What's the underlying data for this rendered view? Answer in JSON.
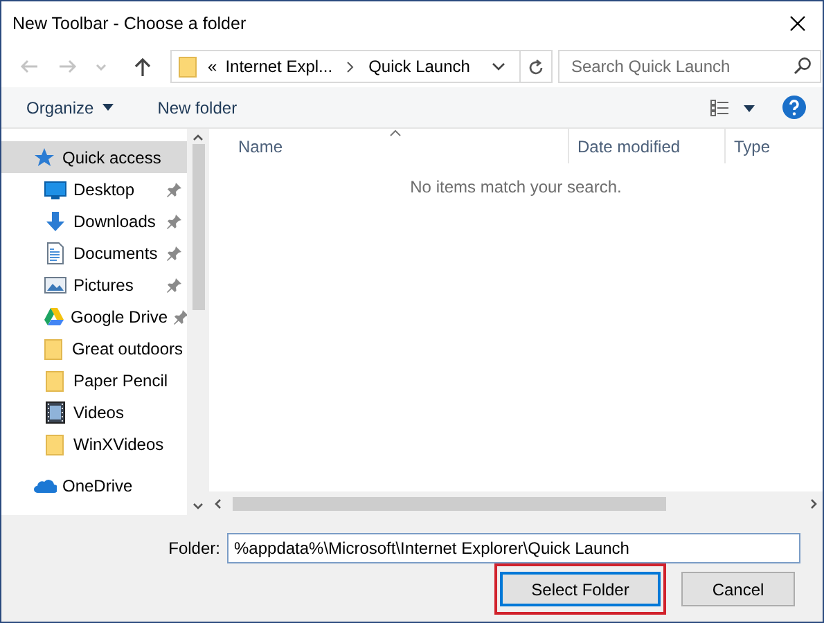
{
  "window": {
    "title": "New Toolbar - Choose a folder"
  },
  "navigation": [
    {
      "kind": "back",
      "disabled": true
    },
    {
      "kind": "forward",
      "disabled": true
    },
    {
      "kind": "recent",
      "disabled": true
    },
    {
      "kind": "up",
      "disabled": false
    }
  ],
  "address_bar": {
    "overflow": "«",
    "breadcrumbs": [
      "Internet Expl...",
      "Quick Launch"
    ]
  },
  "search": {
    "placeholder": "Search Quick Launch"
  },
  "toolbar": [
    {
      "label": "Organize",
      "kind": "menu"
    },
    {
      "label": "New folder",
      "kind": "button"
    }
  ],
  "sidebar": {
    "items": [
      {
        "label": "Quick access",
        "selected": true,
        "children": [
          {
            "label": "Desktop",
            "pinned": true,
            "selected": false
          },
          {
            "label": "Downloads",
            "pinned": true,
            "selected": false
          },
          {
            "label": "Documents",
            "pinned": true,
            "selected": false
          },
          {
            "label": "Pictures",
            "pinned": true,
            "selected": false
          },
          {
            "label": "Google Drive",
            "pinned": true,
            "selected": false
          },
          {
            "label": "Great outdoors",
            "pinned": false,
            "selected": false
          },
          {
            "label": "Paper Pencil",
            "pinned": false,
            "selected": false
          },
          {
            "label": "Videos",
            "pinned": false,
            "selected": false
          },
          {
            "label": "WinXVideos",
            "pinned": false,
            "selected": false
          }
        ]
      },
      {
        "label": "OneDrive",
        "selected": false
      }
    ]
  },
  "file_list": {
    "columns": [
      {
        "label": "Name",
        "sorted": true
      },
      {
        "label": "Date modified",
        "sorted": false
      },
      {
        "label": "Type",
        "sorted": false
      }
    ],
    "empty_message": "No items match your search."
  },
  "footer": {
    "folder_label": "Folder:",
    "folder_value": "%appdata%\\Microsoft\\Internet Explorer\\Quick Launch",
    "buttons": [
      {
        "label": "Select Folder",
        "default": true,
        "highlighted": true
      },
      {
        "label": "Cancel",
        "default": false,
        "highlighted": false
      }
    ]
  }
}
